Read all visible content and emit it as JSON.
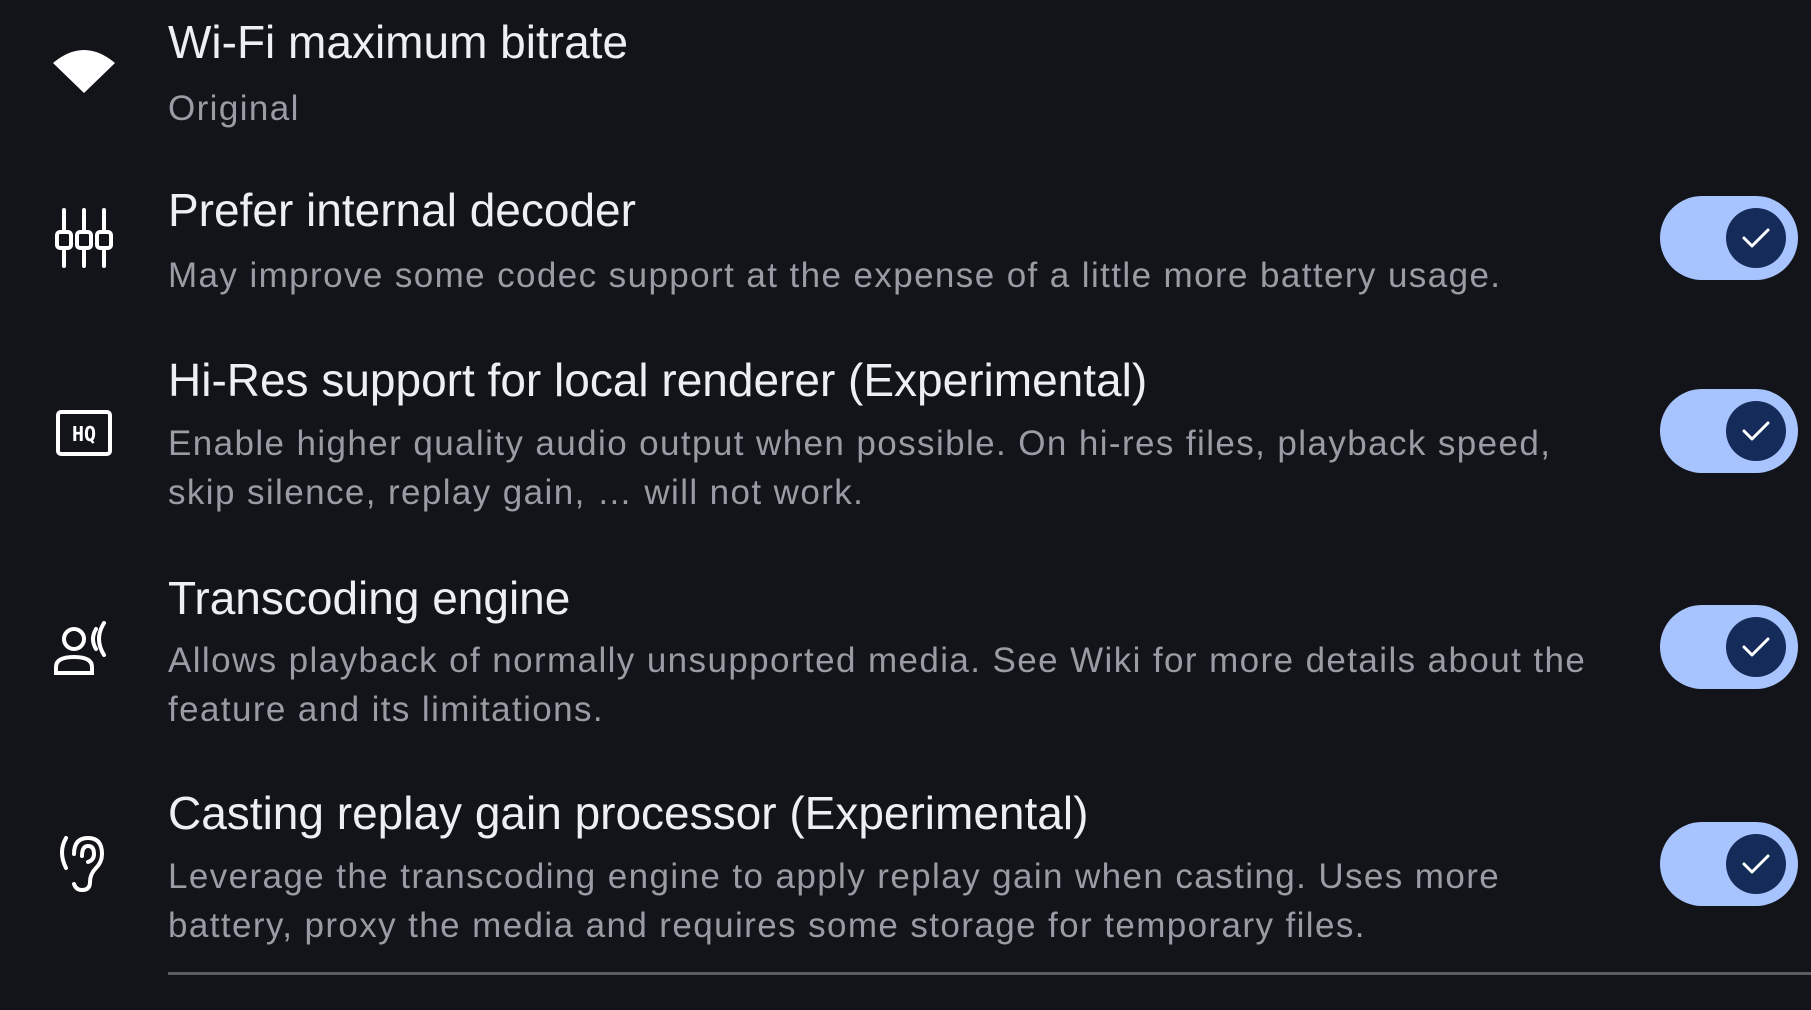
{
  "settings": [
    {
      "title": "Wi-Fi maximum bitrate",
      "summary": "Original",
      "icon": "wifi-icon"
    },
    {
      "title": "Prefer internal decoder",
      "summary": "May improve some codec support at the expense of a little more battery usage.",
      "icon": "equalizer-sliders-icon",
      "toggle_on": true
    },
    {
      "title": "Hi-Res support for local renderer (Experimental)",
      "summary": "Enable higher quality audio output when possible. On hi-res files, playback speed, skip silence, replay gain, … will not work.",
      "icon": "hq-icon",
      "toggle_on": true
    },
    {
      "title": "Transcoding engine",
      "summary": "Allows playback of normally unsupported media. See Wiki for more details about the feature and its limitations.",
      "icon": "person-voice-icon",
      "toggle_on": true
    },
    {
      "title": "Casting replay gain processor (Experimental)",
      "summary": "Leverage the transcoding engine to apply replay gain when casting. Uses more battery, proxy the media and requires some storage for temporary files.",
      "icon": "hearing-icon",
      "toggle_on": true
    }
  ],
  "colors": {
    "background": "#131419",
    "title": "#eeeff5",
    "summary": "#9a9ca5",
    "switch_track": "#a8c4ff",
    "switch_thumb": "#152c5b"
  }
}
